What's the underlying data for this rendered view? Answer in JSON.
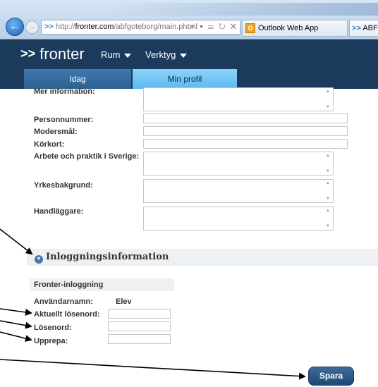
{
  "browser": {
    "address_protocol": "http://",
    "address_domain": "fronter.com",
    "address_path": "/abfgoteborg/main.phtml",
    "address_tools": "⌕ ▾ ☰ ↻ ✕",
    "tabs": [
      {
        "label": "Outlook Web App",
        "icon": "O"
      },
      {
        "label": "ABF"
      }
    ],
    "back_glyph": "←",
    "forward_glyph": "→"
  },
  "app": {
    "logo_text": "fronter",
    "logo_prefix": ">>",
    "menu": [
      {
        "label": "Rum"
      },
      {
        "label": "Verktyg"
      }
    ],
    "tabs": [
      {
        "label": "Idag"
      },
      {
        "label": "Min profil",
        "active": true
      }
    ]
  },
  "form": {
    "fields": [
      {
        "label": "Mer information:",
        "type": "textarea"
      },
      {
        "label": "Personnummer:",
        "type": "text",
        "value": ""
      },
      {
        "label": "Modersmål:",
        "type": "text",
        "value": ""
      },
      {
        "label": "Körkort:",
        "type": "text",
        "value": ""
      },
      {
        "label": "Arbete och praktik i Sverige:",
        "type": "textarea"
      },
      {
        "label": "Yrkesbakgrund:",
        "type": "textarea"
      },
      {
        "label": "Handläggare:",
        "type": "textarea"
      }
    ],
    "login_section": {
      "title": "Inloggningsinformation",
      "subsection_title": "Fronter-inloggning",
      "username_label": "Användarnamn:",
      "username_value": "Elev",
      "current_password_label": "Aktuellt lösenord:",
      "new_password_label": "Lösenord:",
      "repeat_label": "Upprepa:"
    },
    "save_label": "Spara"
  },
  "colors": {
    "header_bg": "#1b3a5c",
    "active_tab": "#5bb8f0",
    "save_button": "#2a5a8a",
    "annotation_arrow": "#000000"
  }
}
